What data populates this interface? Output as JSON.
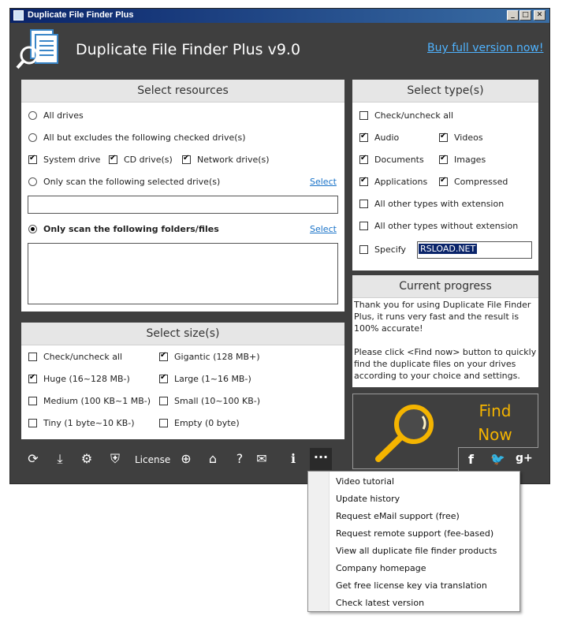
{
  "window": {
    "title": "Duplicate File Finder Plus",
    "min_label": "_",
    "max_label": "□",
    "close_label": "✕"
  },
  "header": {
    "title": "Duplicate File Finder Plus v9.0",
    "buy_link": "Buy full version now!"
  },
  "resources": {
    "heading": "Select resources",
    "all_drives": "All drives",
    "all_but": "All but excludes the following checked drive(s)",
    "system_drive": "System drive",
    "cd_drive": "CD drive(s)",
    "network_drive": "Network drive(s)",
    "only_selected_drives": "Only scan the following selected drive(s)",
    "select_link_1": "Select",
    "drives_value": "",
    "only_folders": "Only scan the following folders/files",
    "select_link_2": "Select",
    "folders_value": ""
  },
  "size": {
    "heading": "Select size(s)",
    "check_all": "Check/uncheck all",
    "gigantic": "Gigantic (128 MB+)",
    "huge": "Huge (16~128 MB-)",
    "large": "Large (1~16 MB-)",
    "medium": "Medium (100 KB~1 MB-)",
    "small": "Small (10~100 KB-)",
    "tiny": "Tiny (1 byte~10 KB-)",
    "empty": "Empty (0 byte)"
  },
  "types": {
    "heading": "Select type(s)",
    "check_all": "Check/uncheck all",
    "audio": "Audio",
    "videos": "Videos",
    "documents": "Documents",
    "images": "Images",
    "applications": "Applications",
    "compressed": "Compressed",
    "other_with_ext": "All other types with extension",
    "other_without_ext": "All other types without extension",
    "specify": "Specify",
    "specify_value": "RSLOAD.NET"
  },
  "progress": {
    "heading": "Current progress",
    "line1": "Thank you for using Duplicate File Finder Plus, it runs very fast and the result is 100% accurate!",
    "line2": "Please click <Find now> button to quickly find the duplicate files on your drives according to your choice and settings."
  },
  "find": {
    "line1": "Find",
    "line2": "Now"
  },
  "social": {
    "facebook": "f",
    "twitter": "🐦",
    "gplus": "g+"
  },
  "toolbar": {
    "license": "License",
    "more": "···"
  },
  "menu": {
    "items": [
      "Video tutorial",
      "Update history",
      "Request eMail support (free)",
      "Request remote support (fee-based)",
      "View all duplicate file finder products",
      "Company homepage",
      "Get free license key via translation",
      "Check latest version"
    ]
  },
  "colors": {
    "dark_bg": "#3f3f3f",
    "accent_yellow": "#f4b400",
    "link_blue": "#4fb3ff"
  }
}
